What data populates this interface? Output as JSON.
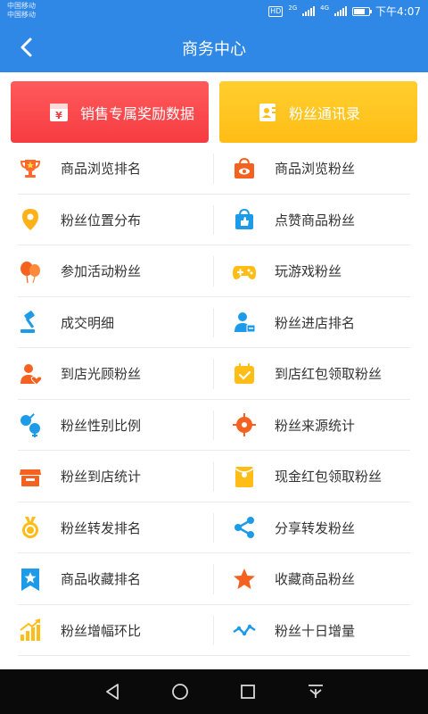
{
  "status": {
    "carrier1": "中国移动",
    "carrier2": "中国移动",
    "hd": "HD",
    "net1": "2G",
    "net2": "4G",
    "time": "下午4:07"
  },
  "header": {
    "title": "商务中心"
  },
  "banners": [
    {
      "label": "销售专属奖励数据",
      "icon": "gift-box-icon",
      "color": "#f63c41"
    },
    {
      "label": "粉丝通讯录",
      "icon": "contact-book-icon",
      "color": "#ffbd16"
    }
  ],
  "menu": [
    {
      "label": "商品浏览排名",
      "icon": "trophy-icon"
    },
    {
      "label": "商品浏览粉丝",
      "icon": "shopping-bag-eye-icon"
    },
    {
      "label": "粉丝位置分布",
      "icon": "location-pin-icon"
    },
    {
      "label": "点赞商品粉丝",
      "icon": "bag-thumb-up-icon"
    },
    {
      "label": "参加活动粉丝",
      "icon": "balloons-icon"
    },
    {
      "label": "玩游戏粉丝",
      "icon": "gamepad-icon"
    },
    {
      "label": "成交明细",
      "icon": "gavel-icon"
    },
    {
      "label": "粉丝进店排名",
      "icon": "user-store-icon"
    },
    {
      "label": "到店光顾粉丝",
      "icon": "user-heart-icon"
    },
    {
      "label": "到店红包领取粉丝",
      "icon": "calendar-check-icon"
    },
    {
      "label": "粉丝性别比例",
      "icon": "gender-icon"
    },
    {
      "label": "粉丝来源统计",
      "icon": "target-icon"
    },
    {
      "label": "粉丝到店统计",
      "icon": "store-icon"
    },
    {
      "label": "现金红包领取粉丝",
      "icon": "red-envelope-icon"
    },
    {
      "label": "粉丝转发排名",
      "icon": "medal-icon"
    },
    {
      "label": "分享转发粉丝",
      "icon": "share-icon"
    },
    {
      "label": "商品收藏排名",
      "icon": "bookmark-star-icon"
    },
    {
      "label": "收藏商品粉丝",
      "icon": "star-icon"
    },
    {
      "label": "粉丝增幅环比",
      "icon": "bar-chart-up-icon"
    },
    {
      "label": "粉丝十日增量",
      "icon": "line-trend-icon"
    }
  ]
}
